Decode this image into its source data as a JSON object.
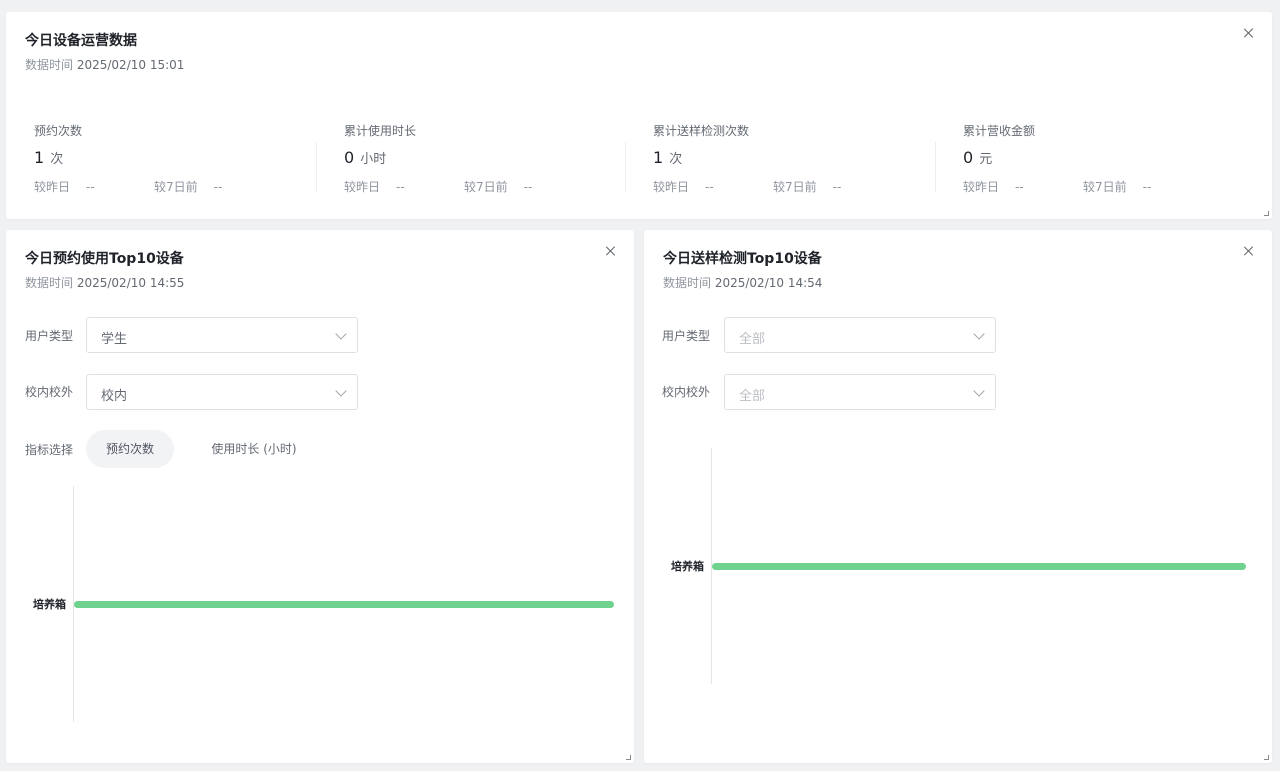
{
  "overview": {
    "title": "今日设备运营数据",
    "time_label": "数据时间",
    "time_value": "2025/02/10 15:01",
    "stats": [
      {
        "label": "预约次数",
        "value": "1",
        "unit": "次",
        "cmp1_label": "较昨日",
        "cmp1_value": "--",
        "cmp2_label": "较7日前",
        "cmp2_value": "--"
      },
      {
        "label": "累计使用时长",
        "value": "0",
        "unit": "小时",
        "cmp1_label": "较昨日",
        "cmp1_value": "--",
        "cmp2_label": "较7日前",
        "cmp2_value": "--"
      },
      {
        "label": "累计送样检测次数",
        "value": "1",
        "unit": "次",
        "cmp1_label": "较昨日",
        "cmp1_value": "--",
        "cmp2_label": "较7日前",
        "cmp2_value": "--"
      },
      {
        "label": "累计营收金额",
        "value": "0",
        "unit": "元",
        "cmp1_label": "较昨日",
        "cmp1_value": "--",
        "cmp2_label": "较7日前",
        "cmp2_value": "--"
      }
    ]
  },
  "booking": {
    "title": "今日预约使用Top10设备",
    "time_label": "数据时间",
    "time_value": "2025/02/10 14:55",
    "user_type_label": "用户类型",
    "user_type_value": "学生",
    "campus_label": "校内校外",
    "campus_value": "校内",
    "metric_label": "指标选择",
    "metric_options": [
      "预约次数",
      "使用时长 (小时)"
    ],
    "metric_selected": "预约次数"
  },
  "sample": {
    "title": "今日送样检测Top10设备",
    "time_label": "数据时间",
    "time_value": "2025/02/10 14:54",
    "user_type_label": "用户类型",
    "user_type_placeholder": "全部",
    "campus_label": "校内校外",
    "campus_placeholder": "全部"
  },
  "chart_data": [
    {
      "type": "bar",
      "orientation": "horizontal",
      "categories": [
        "培养箱"
      ],
      "values": [
        1
      ],
      "color": "#6fd28f",
      "xlim": [
        0,
        1
      ]
    },
    {
      "type": "bar",
      "orientation": "horizontal",
      "categories": [
        "培养箱"
      ],
      "values": [
        1
      ],
      "color": "#6fd28f",
      "xlim": [
        0,
        1
      ]
    }
  ]
}
